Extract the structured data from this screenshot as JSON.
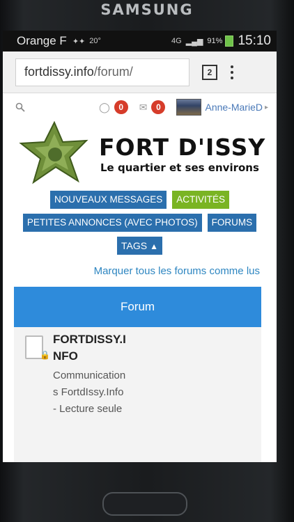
{
  "device": {
    "brand": "SAMSUNG"
  },
  "status_bar": {
    "carrier": "Orange F",
    "temperature": "20°",
    "network": "4G",
    "battery": "91%",
    "time": "15:10"
  },
  "browser": {
    "url_domain": "fortdissy.info",
    "url_path": "/forum/",
    "tab_count": "2"
  },
  "userbar": {
    "notifications_count": "0",
    "messages_count": "0",
    "username": "Anne-MarieD",
    "caret": "▸"
  },
  "logo": {
    "title": "FORT D'ISSY",
    "subtitle": "Le quartier et ses environs"
  },
  "nav": {
    "new_messages": "NOUVEAUX MESSAGES",
    "activities": "ACTIVITÉS",
    "classifieds": "PETITES ANNONCES (AVEC PHOTOS)",
    "forums": "FORUMS",
    "tags": "TAGS",
    "tags_icon": "▲"
  },
  "mark_read": "Marquer tous les forums comme lus",
  "forum_header": "Forum",
  "forum_node": {
    "title": "FORTDISSY.INFO",
    "description": "Communications FortdIssy.Info - Lecture seule"
  },
  "colors": {
    "nav_blue": "#2b6fad",
    "nav_green": "#7ab423",
    "forum_header": "#2e8bdb",
    "badge_red": "#d63c2a"
  }
}
